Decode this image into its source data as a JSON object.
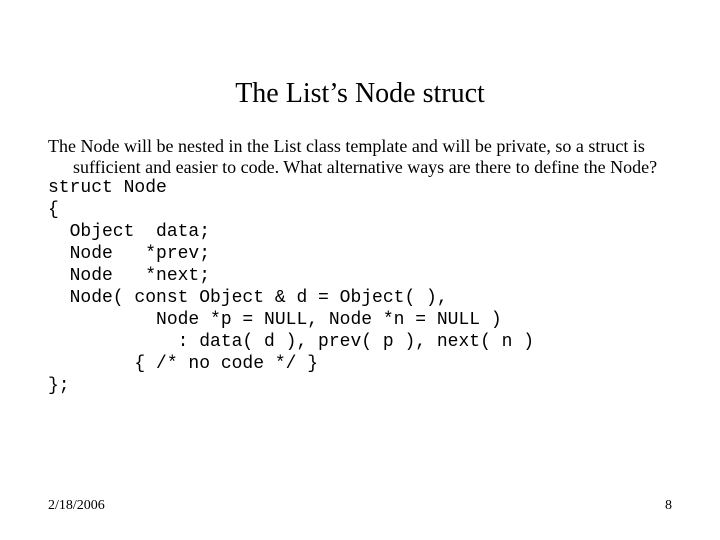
{
  "slide": {
    "title": "The List’s Node struct",
    "paragraph": "The Node will be nested in the List class template and will be private, so a struct is sufficient and easier to code.  What alternative ways are there to define the Node?",
    "code_lines": {
      "l0": "struct Node",
      "l1": "{",
      "l2": "  Object  data;",
      "l3": "  Node   *prev;",
      "l4": "  Node   *next;",
      "l5": "",
      "l6": "  Node( const Object & d = Object( ),",
      "l7": "          Node *p = NULL, Node *n = NULL )",
      "l8": "            : data( d ), prev( p ), next( n )",
      "l9": "        { /* no code */ }",
      "l10": "};"
    },
    "footer": {
      "date": "2/18/2006",
      "page": "8"
    }
  }
}
